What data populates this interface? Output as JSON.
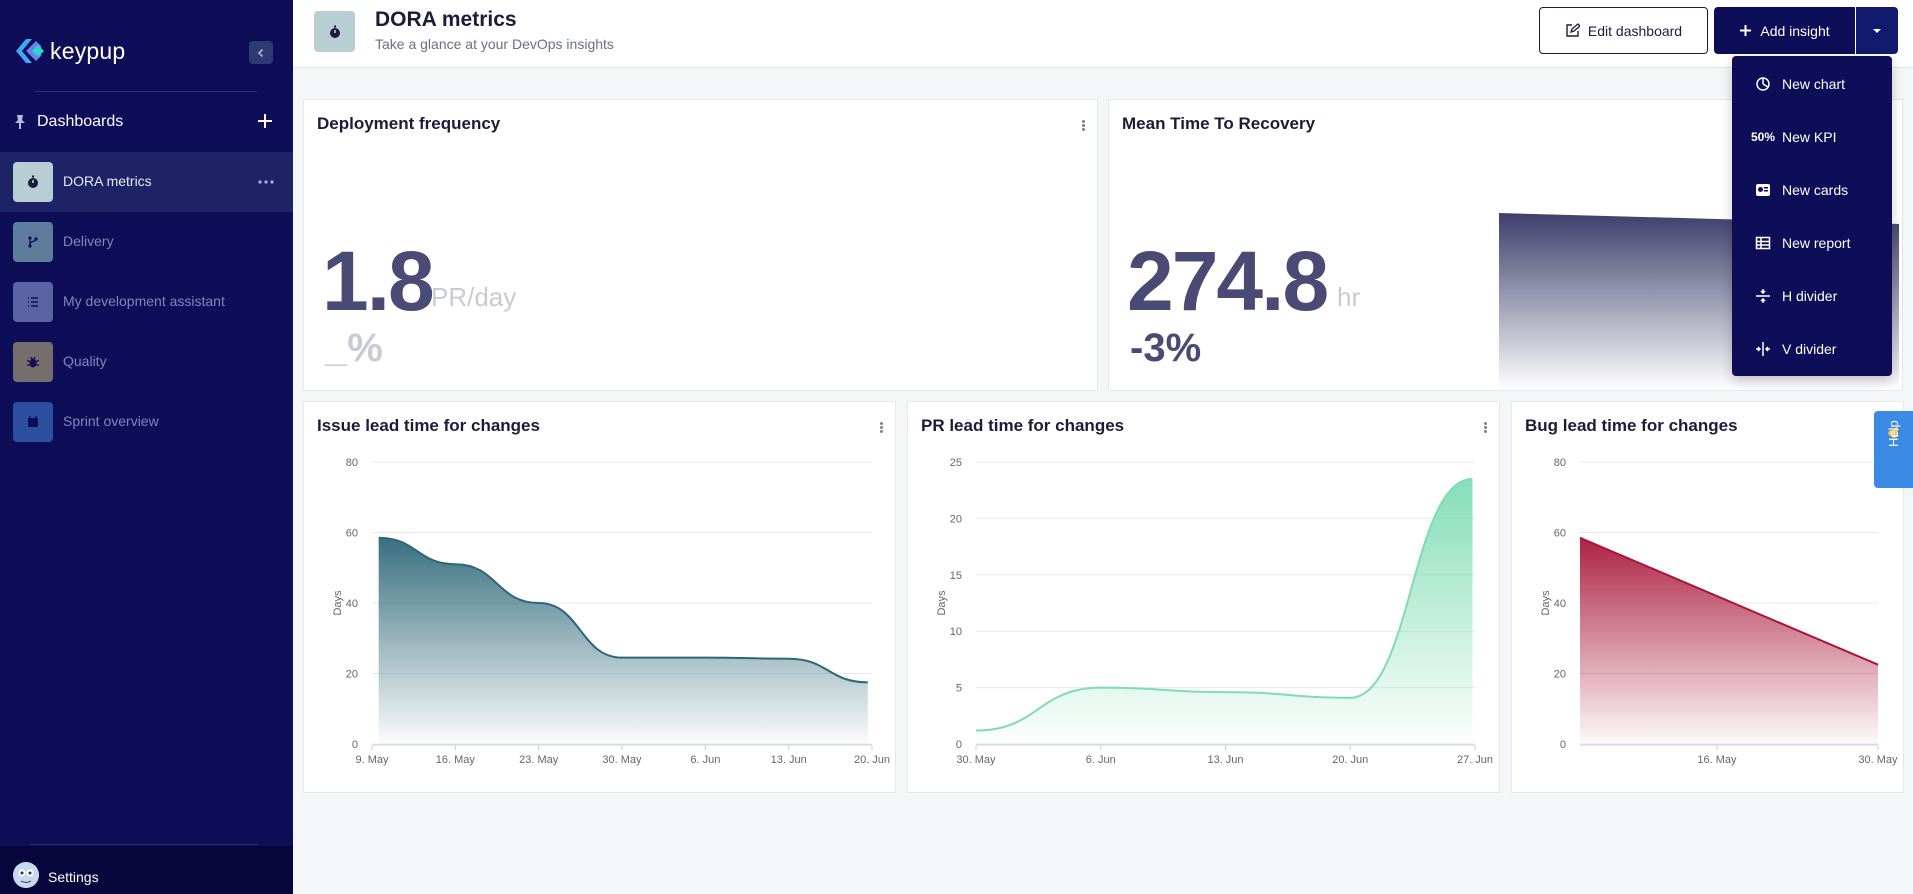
{
  "sidebar": {
    "logo_text": "keypup",
    "dashboards_title": "Dashboards",
    "items": [
      {
        "label": "DORA metrics",
        "color": "#b9cdd5"
      },
      {
        "label": "Delivery",
        "color": "#5f7c9c"
      },
      {
        "label": "My development assistant",
        "color": "#5a63a3"
      },
      {
        "label": "Quality",
        "color": "#756e6c"
      },
      {
        "label": "Sprint overview",
        "color": "#2c4fa0"
      }
    ],
    "settings_label": "Settings"
  },
  "header": {
    "title": "DORA metrics",
    "subtitle": "Take a glance at your DevOps insights",
    "edit_label": "Edit dashboard",
    "add_label": "Add insight"
  },
  "menu": {
    "items": [
      {
        "label": "New chart",
        "icon": "chart-icon"
      },
      {
        "label": "New KPI",
        "icon": "kpi-icon"
      },
      {
        "label": "New cards",
        "icon": "cards-icon"
      },
      {
        "label": "New report",
        "icon": "report-icon"
      },
      {
        "label": "H divider",
        "icon": "h-divider-icon"
      },
      {
        "label": "V divider",
        "icon": "v-divider-icon"
      }
    ],
    "kpi_icon_text": "50%"
  },
  "kpis": {
    "deploy": {
      "title": "Deployment frequency",
      "value": "1.8",
      "unit": "PR/day",
      "delta": "_%"
    },
    "mttr": {
      "title": "Mean Time To Recovery",
      "value": "274.8",
      "unit": "hr",
      "delta": "-3%"
    }
  },
  "help_label": "Help",
  "colors": {
    "sidebar": "#0d0d58",
    "accent": "#0d0d58",
    "issue": "#2e6878",
    "pr": "#7fdcb4",
    "bug": "#a8163a"
  },
  "chart_data": [
    {
      "type": "area",
      "title": "Issue lead time for changes",
      "ylabel": "Days",
      "ylim": [
        0,
        80
      ],
      "yticks": [
        "0",
        "20",
        "40",
        "60",
        "80"
      ],
      "xticks": [
        "9. May",
        "16. May",
        "23. May",
        "30. May",
        "6. Jun",
        "13. Jun",
        "20. Jun"
      ],
      "series": [
        {
          "values": [
            58.5,
            51,
            40,
            24.5,
            24.5,
            24.2,
            17.5
          ]
        }
      ]
    },
    {
      "type": "area",
      "title": "PR lead time for changes",
      "ylabel": "Days",
      "ylim": [
        0,
        25
      ],
      "yticks": [
        "0",
        "5",
        "10",
        "15",
        "20",
        "25"
      ],
      "xticks": [
        "30. May",
        "6. Jun",
        "13. Jun",
        "20. Jun",
        "27. Jun"
      ],
      "series": [
        {
          "values": [
            1.2,
            5,
            4.6,
            4.1,
            23.5
          ]
        }
      ]
    },
    {
      "type": "area",
      "title": "Bug lead time for changes",
      "ylabel": "Days",
      "ylim": [
        0,
        80
      ],
      "yticks": [
        "0",
        "20",
        "40",
        "60",
        "80"
      ],
      "xticks": [
        "16. May",
        "30. May"
      ],
      "series": [
        {
          "values": [
            58.5,
            22.5
          ]
        }
      ]
    }
  ]
}
